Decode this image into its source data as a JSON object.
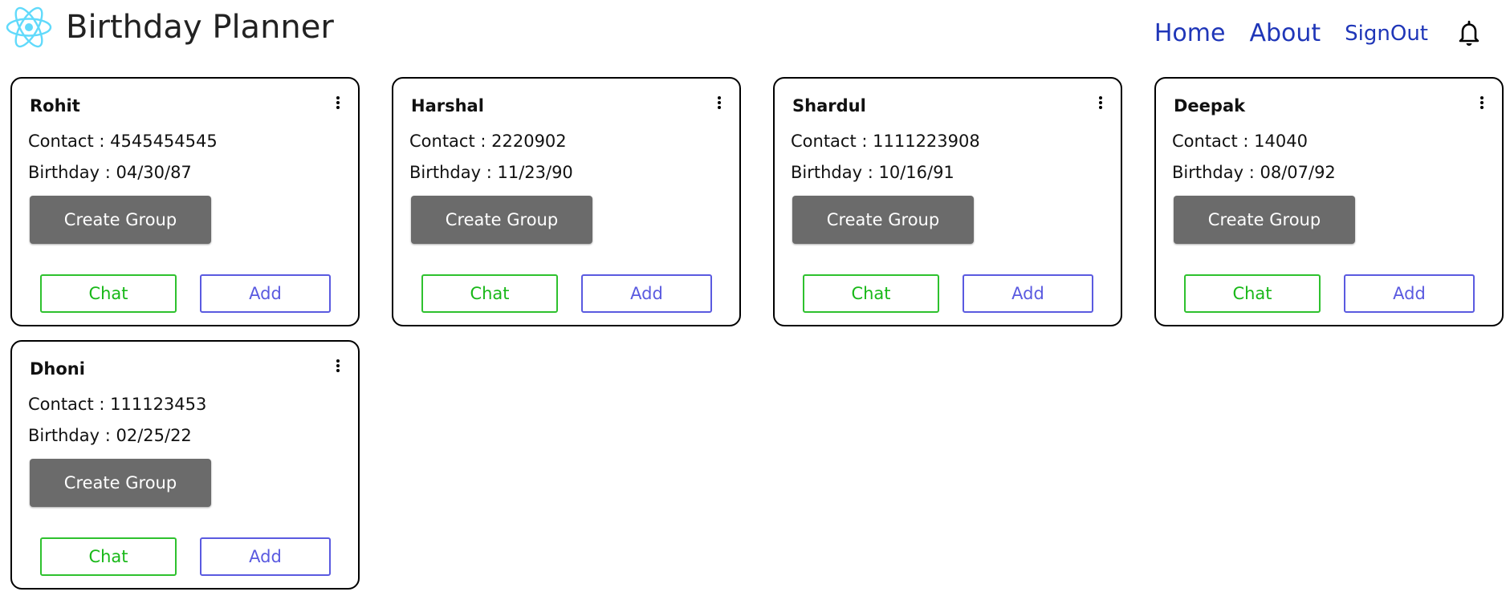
{
  "header": {
    "logo_icon": "react-atom-icon",
    "title": "Birthday Planner",
    "nav": {
      "home": "Home",
      "about": "About",
      "signout": "SignOut"
    },
    "bell_icon": "bell-icon"
  },
  "colors": {
    "nav_link": "#1f36b8",
    "create_group_bg": "#6b6b6b",
    "chat_border": "#2ec12e",
    "add_border": "#5a5ae0",
    "logo": "#61dafb"
  },
  "cards": [
    {
      "name": "Rohit",
      "contact": "Contact : 4545454545",
      "birthday": "Birthday : 04/30/87",
      "create_group": "Create Group",
      "chat": "Chat",
      "add": "Add"
    },
    {
      "name": "Harshal",
      "contact": "Contact : 2220902",
      "birthday": "Birthday : 11/23/90",
      "create_group": "Create Group",
      "chat": "Chat",
      "add": "Add"
    },
    {
      "name": "Shardul",
      "contact": "Contact : 1111223908",
      "birthday": "Birthday : 10/16/91",
      "create_group": "Create Group",
      "chat": "Chat",
      "add": "Add"
    },
    {
      "name": "Deepak",
      "contact": "Contact : 14040",
      "birthday": "Birthday : 08/07/92",
      "create_group": "Create Group",
      "chat": "Chat",
      "add": "Add"
    },
    {
      "name": "Dhoni",
      "contact": "Contact : 111123453",
      "birthday": "Birthday : 02/25/22",
      "create_group": "Create Group",
      "chat": "Chat",
      "add": "Add"
    }
  ]
}
